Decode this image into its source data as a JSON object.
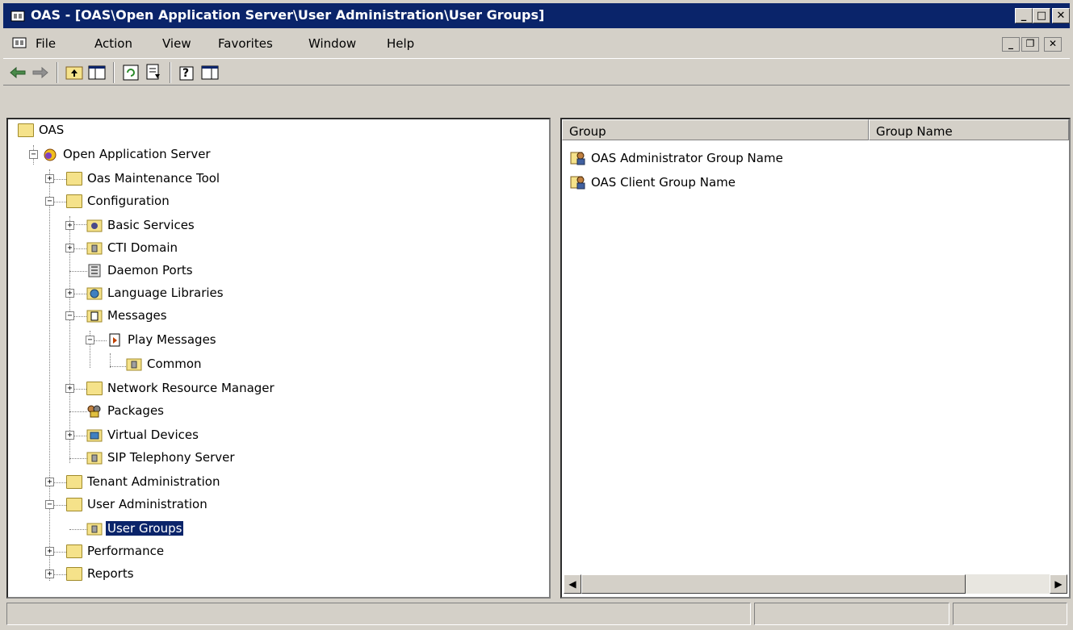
{
  "window": {
    "title": "OAS - [OAS\\Open Application Server\\User Administration\\User Groups]",
    "minimize": "_",
    "maximize": "□",
    "close": "✕"
  },
  "menu": {
    "items": [
      "File",
      "Action",
      "View",
      "Favorites",
      "Window",
      "Help"
    ],
    "child_minimize": "_",
    "child_restore": "❐",
    "child_close": "✕"
  },
  "toolbar": {
    "buttons": [
      "back-icon",
      "forward-icon",
      "up-one-level-icon",
      "show-hide-console-tree-icon",
      "refresh-icon",
      "export-list-icon",
      "help-icon",
      "show-hide-action-pane-icon"
    ]
  },
  "tree": {
    "nodes": [
      {
        "label": "OAS"
      },
      {
        "label": "Open Application Server"
      },
      {
        "label": "Oas Maintenance Tool"
      },
      {
        "label": "Configuration"
      },
      {
        "label": "Basic Services"
      },
      {
        "label": "CTI Domain"
      },
      {
        "label": "Daemon Ports"
      },
      {
        "label": "Language Libraries"
      },
      {
        "label": "Messages"
      },
      {
        "label": "Play Messages"
      },
      {
        "label": "Common"
      },
      {
        "label": "Network Resource Manager"
      },
      {
        "label": "Packages"
      },
      {
        "label": "Virtual Devices"
      },
      {
        "label": "SIP Telephony Server"
      },
      {
        "label": "Tenant Administration"
      },
      {
        "label": "User Administration"
      },
      {
        "label": "User Groups"
      },
      {
        "label": "Performance"
      },
      {
        "label": "Reports"
      }
    ]
  },
  "list": {
    "columns": [
      "Group",
      "Group Name"
    ],
    "rows": [
      {
        "group": "OAS Administrator Group Name",
        "group_name": ""
      },
      {
        "group": "OAS Client Group Name",
        "group_name": ""
      }
    ]
  },
  "scrollbar": {
    "left_arrow": "◀",
    "right_arrow": "▶"
  },
  "colors": {
    "titlebar": "#0a246a",
    "selection": "#0a246a",
    "face": "#d4d0c8"
  }
}
